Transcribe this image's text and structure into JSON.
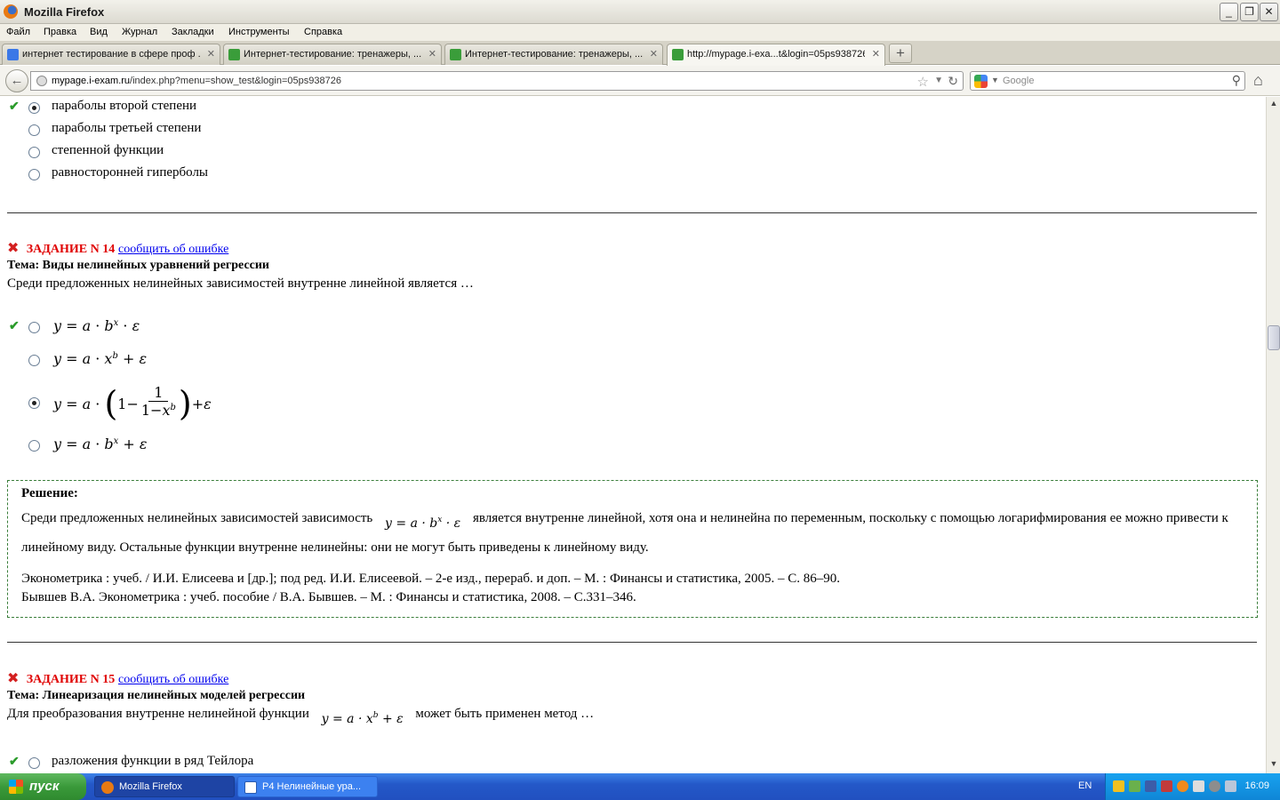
{
  "window": {
    "title": "Mozilla Firefox"
  },
  "menu": [
    "Файл",
    "Правка",
    "Вид",
    "Журнал",
    "Закладки",
    "Инструменты",
    "Справка"
  ],
  "tabs": [
    {
      "label": "интернет тестирование в сфере проф ...",
      "icon": "google-icon",
      "active": false
    },
    {
      "label": "Интернет-тестирование: тренажеры, ...",
      "icon": "envelope-icon",
      "active": false
    },
    {
      "label": "Интернет-тестирование: тренажеры, ...",
      "icon": "envelope-icon",
      "active": false
    },
    {
      "label": "http://mypage.i-exa...t&login=05ps938726",
      "icon": "envelope-icon",
      "active": true
    }
  ],
  "nav": {
    "url_host": "mypage.i-exam.ru",
    "url_path": "/index.php?menu=show_test&login=05ps938726",
    "search_placeholder": "Google"
  },
  "prev_task_options": [
    {
      "text": "параболы второй степени",
      "selected": true,
      "correct": true
    },
    {
      "text": "параболы третьей степени",
      "selected": false,
      "correct": false
    },
    {
      "text": "степенной функции",
      "selected": false,
      "correct": false
    },
    {
      "text": "равносторонней гиперболы",
      "selected": false,
      "correct": false
    }
  ],
  "task14": {
    "number": "ЗАДАНИЕ N 14",
    "report_link": "сообщить об ошибке",
    "topic": "Тема: Виды нелинейных уравнений регрессии",
    "question": "Среди предложенных нелинейных зависимостей внутренне линейной является …",
    "options": [
      {
        "formula": "y = a · b^x · ε",
        "selected": false,
        "correct": true
      },
      {
        "formula": "y = a · x^b + ε",
        "selected": false,
        "correct": false
      },
      {
        "formula": "y = a · (1 − 1/(1 − x^b)) + ε",
        "selected": true,
        "correct": false
      },
      {
        "formula": "y = a · b^x + ε",
        "selected": false,
        "correct": false
      }
    ],
    "solution": {
      "heading": "Решение:",
      "text_before": "Среди предложенных нелинейных зависимостей зависимость",
      "text_after": "является внутренне линейной, хотя она и нелинейна по переменным, поскольку с помощью логарифмирования ее можно привести к линейному виду. Остальные функции внутренне нелинейны: они не могут быть приведены к линейному виду.",
      "ref1": "Эконометрика : учеб. / И.И. Елисеева и [др.]; под ред. И.И. Елисеевой. – 2-е изд., перераб. и доп. – М. : Финансы и статистика, 2005. – С. 86–90.",
      "ref2": "Бывшев В.А. Эконометрика : учеб. пособие / В.А. Бывшев. – М. : Финансы и статистика, 2008. – С.331–346."
    }
  },
  "task15": {
    "number": "ЗАДАНИЕ N 15",
    "report_link": "сообщить об ошибке",
    "topic": "Тема: Линеаризация нелинейных моделей регрессии",
    "question_before": "Для преобразования внутренне нелинейной функции",
    "question_after": "может быть применен метод …",
    "options": [
      {
        "text": "разложения функции в ряд Тейлора",
        "selected": false,
        "correct": true
      }
    ]
  },
  "taskbar": {
    "start_label": "пуск",
    "tasks": [
      {
        "label": "Mozilla Firefox",
        "active": true
      },
      {
        "label": "Р4 Нелинейные ура...",
        "active": false
      }
    ],
    "lang": "EN",
    "clock": "16:09"
  },
  "colors": {
    "task_number": "#e00000",
    "link": "#0000ee",
    "check": "#2a9b2a",
    "x_mark": "#d42020"
  }
}
